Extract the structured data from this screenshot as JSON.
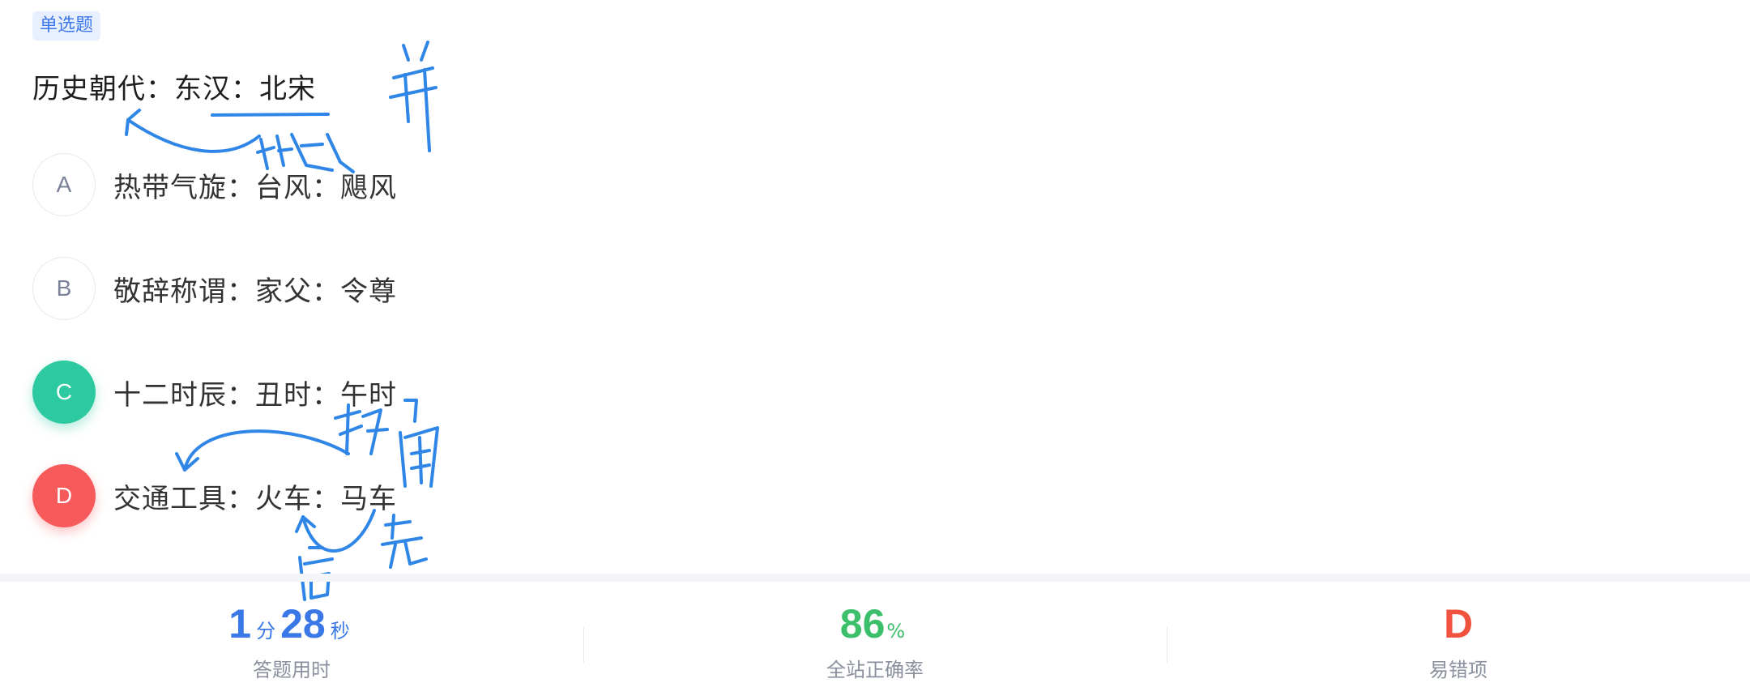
{
  "question": {
    "type_tag": "单选题",
    "stem": "历史朝代：东汉：北宋",
    "options": [
      {
        "letter": "A",
        "text": "热带气旋：台风：飓风",
        "state": "normal"
      },
      {
        "letter": "B",
        "text": "敬辞称谓：家父：令尊",
        "state": "normal"
      },
      {
        "letter": "C",
        "text": "十二时辰：丑时：午时",
        "state": "correct"
      },
      {
        "letter": "D",
        "text": "交通工具：火车：马车",
        "state": "wrong"
      }
    ]
  },
  "stats": {
    "time": {
      "minutes": "1",
      "minutes_unit": "分",
      "seconds": "28",
      "seconds_unit": "秒",
      "label": "答题用时"
    },
    "accuracy": {
      "value": "86",
      "unit": "%",
      "label": "全站正确率"
    },
    "common_wrong": {
      "value": "D",
      "label": "易错项"
    }
  },
  "colors": {
    "accent_blue": "#3b78e7",
    "correct_green": "#2dc9a1",
    "wrong_red": "#f65a5b",
    "accuracy_green": "#3cbf6a",
    "ink_blue": "#2f86e6"
  },
  "annotations": {
    "handwritten_notes": [
      "并",
      "组成",
      "排后",
      "先",
      "后"
    ]
  }
}
